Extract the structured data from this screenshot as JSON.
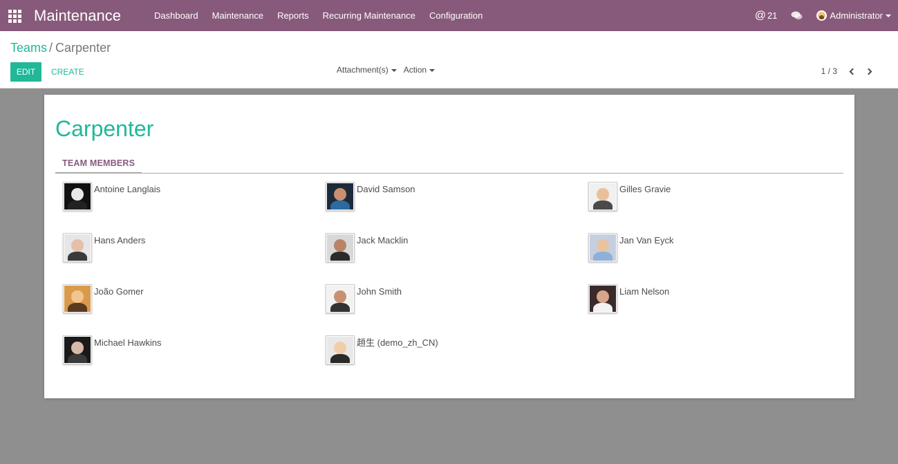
{
  "navbar": {
    "app_name": "Maintenance",
    "menu": [
      "Dashboard",
      "Maintenance",
      "Reports",
      "Recurring Maintenance",
      "Configuration"
    ],
    "mentions_count": "21",
    "user_name": "Administrator",
    "background_color": "#875a7b"
  },
  "breadcrumb": {
    "parent": "Teams",
    "separator": "/",
    "current": "Carpenter"
  },
  "buttons": {
    "edit": "EDIT",
    "create": "CREATE"
  },
  "sidebar": {
    "attachments": "Attachment(s)",
    "action": "Action"
  },
  "pager": {
    "value": "1 / 3"
  },
  "record": {
    "title": "Carpenter",
    "tab_label": "TEAM MEMBERS",
    "accent_color": "#21b799",
    "members": [
      {
        "name": "Antoine Langlais",
        "skin": "#e8e8e8",
        "bg": "#111111",
        "shirt": "#222222"
      },
      {
        "name": "David Samson",
        "skin": "#c89070",
        "bg": "#1d2a3a",
        "shirt": "#2d6a9f"
      },
      {
        "name": "Gilles Gravie",
        "skin": "#eac09a",
        "bg": "#f0f0f0",
        "shirt": "#4a4a4a"
      },
      {
        "name": "Hans Anders",
        "skin": "#e3c0a8",
        "bg": "#e6e6e6",
        "shirt": "#3a3a3a"
      },
      {
        "name": "Jack Macklin",
        "skin": "#b98466",
        "bg": "#d8d8d8",
        "shirt": "#2b2b2b"
      },
      {
        "name": "Jan Van Eyck",
        "skin": "#e9c2a0",
        "bg": "#c5cfe0",
        "shirt": "#8fb0d8"
      },
      {
        "name": "João Gomer",
        "skin": "#f2c48f",
        "bg": "#d99a4a",
        "shirt": "#5a3a20"
      },
      {
        "name": "John Smith",
        "skin": "#c79273",
        "bg": "#f2f2f2",
        "shirt": "#333333"
      },
      {
        "name": "Liam Nelson",
        "skin": "#d6a58a",
        "bg": "#3a2a2a",
        "shirt": "#f2f2f2"
      },
      {
        "name": "Michael Hawkins",
        "skin": "#d8b8a8",
        "bg": "#1a1a1a",
        "shirt": "#3a3a3a"
      },
      {
        "name": "趙生 (demo_zh_CN)",
        "skin": "#f0cfa8",
        "bg": "#e8e8e8",
        "shirt": "#2a2a2a"
      }
    ]
  }
}
